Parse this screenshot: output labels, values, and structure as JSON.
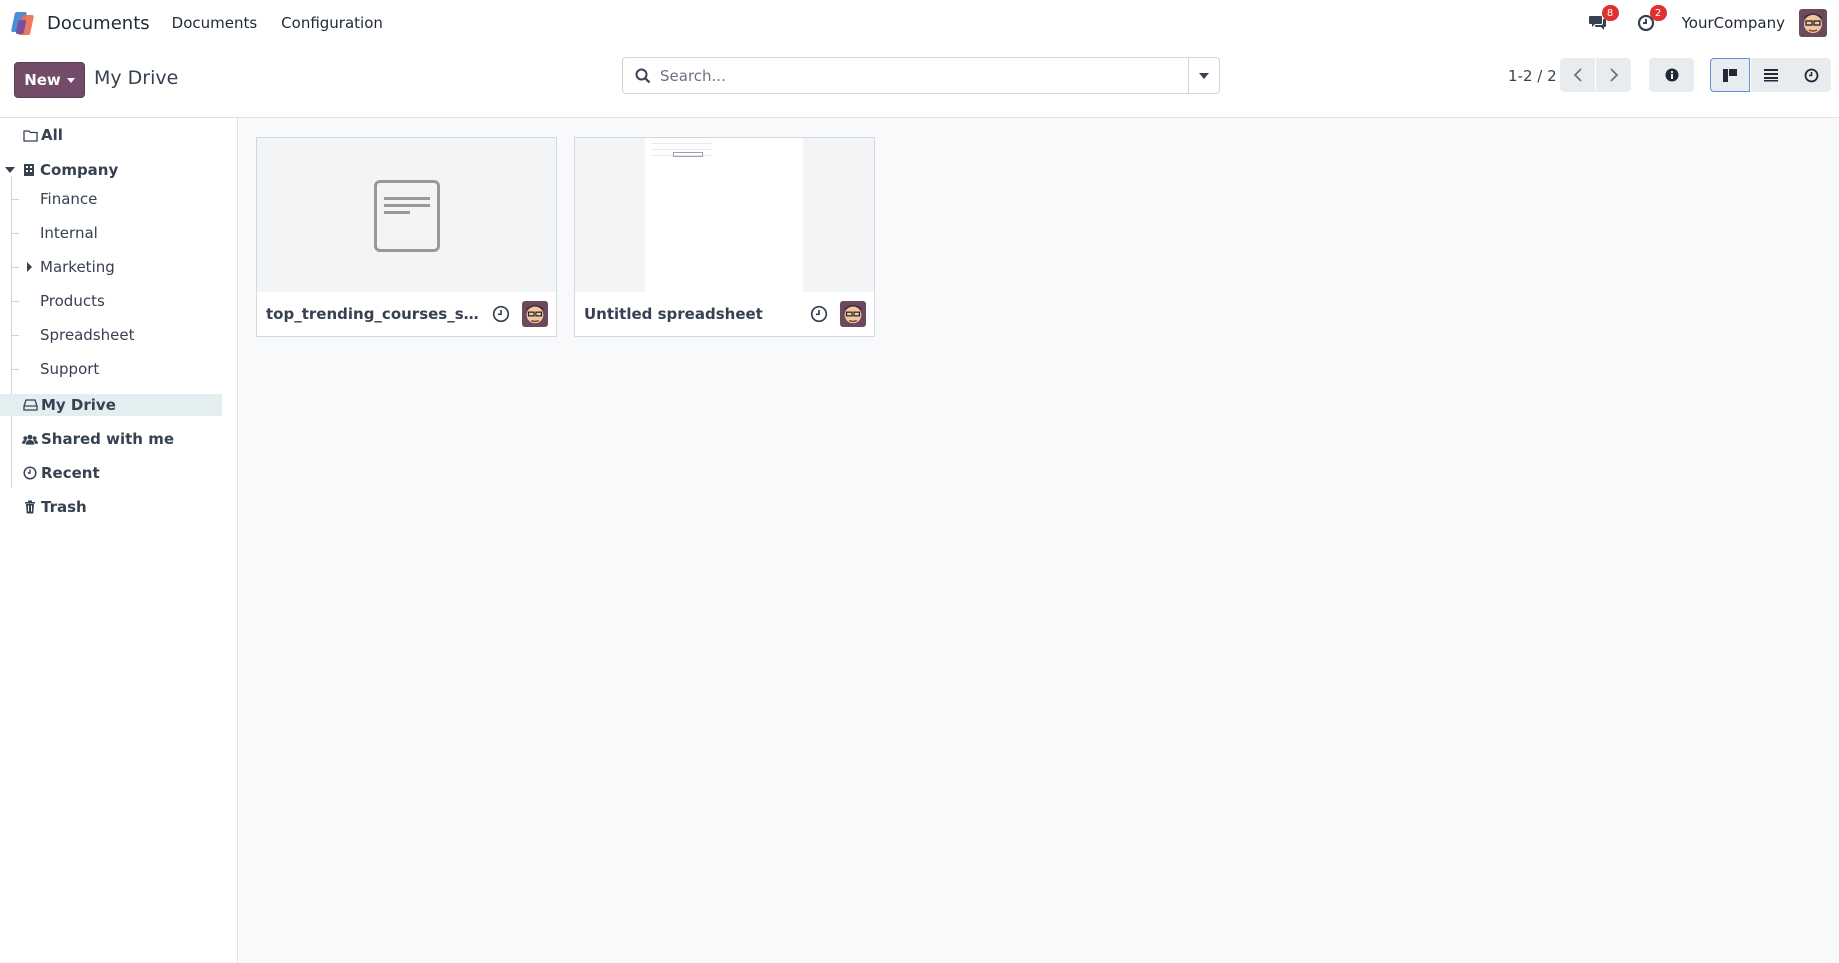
{
  "navbar": {
    "app_name": "Documents",
    "menu": [
      "Documents",
      "Configuration"
    ],
    "messages_badge": "8",
    "activities_badge": "2",
    "company": "YourCompany"
  },
  "control": {
    "new_label": "New",
    "breadcrumb": "My Drive",
    "search_placeholder": "Search...",
    "pager": "1-2 / 2"
  },
  "sidebar": {
    "all": "All",
    "company": "Company",
    "company_children": [
      "Finance",
      "Internal",
      "Marketing",
      "Products",
      "Spreadsheet",
      "Support"
    ],
    "my_drive": "My Drive",
    "shared": "Shared with me",
    "recent": "Recent",
    "trash": "Trash"
  },
  "documents": [
    {
      "name": "top_trending_courses_sni...",
      "preview": "generic-document-icon"
    },
    {
      "name": "Untitled spreadsheet",
      "preview": "spreadsheet-thumbnail"
    }
  ],
  "colors": {
    "primary": "#714b67",
    "badge": "#e03131",
    "selected_row": "#e3eef1"
  }
}
